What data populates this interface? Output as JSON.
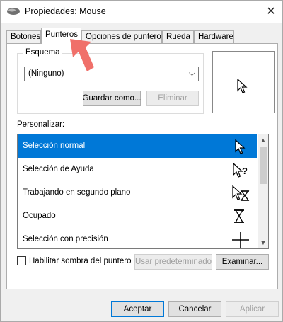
{
  "window": {
    "title": "Propiedades: Mouse",
    "close_glyph": "✕"
  },
  "tabs": [
    {
      "label": "Botones",
      "active": false
    },
    {
      "label": "Punteros",
      "active": true
    },
    {
      "label": "Opciones de puntero",
      "active": false
    },
    {
      "label": "Rueda",
      "active": false
    },
    {
      "label": "Hardware",
      "active": false
    }
  ],
  "scheme": {
    "group_label": "Esquema",
    "selected": "(Ninguno)",
    "save_label": "Guardar como...",
    "delete_label": "Eliminar"
  },
  "customize": {
    "label": "Personalizar:",
    "items": [
      {
        "label": "Selección normal",
        "icon": "arrow-cursor-icon",
        "selected": true
      },
      {
        "label": "Selección de Ayuda",
        "icon": "help-cursor-icon",
        "selected": false
      },
      {
        "label": "Trabajando en segundo plano",
        "icon": "working-cursor-icon",
        "selected": false
      },
      {
        "label": "Ocupado",
        "icon": "hourglass-icon",
        "selected": false
      },
      {
        "label": "Selección con precisión",
        "icon": "crosshair-icon",
        "selected": false
      }
    ]
  },
  "shadow_checkbox": {
    "label": "Habilitar sombra del puntero",
    "checked": false
  },
  "buttons": {
    "default_label": "Usar predeterminado",
    "browse_label": "Examinar...",
    "ok_label": "Aceptar",
    "cancel_label": "Cancelar",
    "apply_label": "Aplicar"
  },
  "colors": {
    "accent": "#0078d7",
    "annotation_arrow": "#f0706a"
  }
}
